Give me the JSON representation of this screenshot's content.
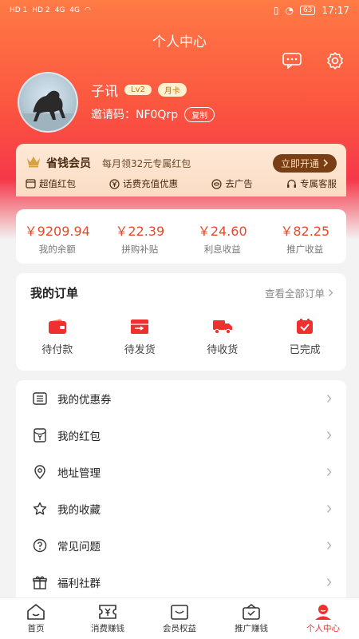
{
  "status": {
    "time": "17:17",
    "battery": "63",
    "left": [
      "HD 1",
      "HD 2",
      "4G",
      "4G"
    ]
  },
  "page": {
    "title": "个人中心"
  },
  "header_icons": [
    {
      "icon": "message-icon"
    },
    {
      "icon": "gear-icon"
    }
  ],
  "profile": {
    "name": "子讯",
    "level": "Lv2",
    "card": "月卡",
    "invite_label": "邀请码：",
    "invite_code": "NF0Qrp",
    "copy_label": "复制"
  },
  "vip": {
    "title": "省钱会员",
    "desc": "每月领32元专属红包",
    "button": "立即开通",
    "perks": [
      {
        "icon": "wallet-icon",
        "label": "超值红包"
      },
      {
        "icon": "yen-icon",
        "label": "话费充值优惠"
      },
      {
        "icon": "eye-icon",
        "label": "去广告"
      },
      {
        "icon": "headset-icon",
        "label": "专属客服"
      }
    ]
  },
  "stats": [
    {
      "value": "￥9209.94",
      "label": "我的余额"
    },
    {
      "value": "￥22.39",
      "label": "拼购补贴"
    },
    {
      "value": "￥24.60",
      "label": "利息收益"
    },
    {
      "value": "￥82.25",
      "label": "推广收益"
    }
  ],
  "orders": {
    "title": "我的订单",
    "view_all": "查看全部订单",
    "items": [
      {
        "icon": "wallet-icon",
        "label": "待付款"
      },
      {
        "icon": "package-icon",
        "label": "待发货"
      },
      {
        "icon": "truck-icon",
        "label": "待收货"
      },
      {
        "icon": "check-box-icon",
        "label": "已完成"
      }
    ]
  },
  "menu": [
    {
      "icon": "coupon-icon",
      "label": "我的优惠券"
    },
    {
      "icon": "red-packet-icon",
      "label": "我的红包"
    },
    {
      "icon": "location-icon",
      "label": "地址管理"
    },
    {
      "icon": "star-icon",
      "label": "我的收藏"
    },
    {
      "icon": "question-icon",
      "label": "常见问题"
    },
    {
      "icon": "gift-icon",
      "label": "福利社群"
    }
  ],
  "tabs": [
    {
      "icon": "home-icon",
      "label": "首页"
    },
    {
      "icon": "yen-ticket-icon",
      "label": "消费赚钱"
    },
    {
      "icon": "member-box-icon",
      "label": "会员权益"
    },
    {
      "icon": "promote-icon",
      "label": "推广赚钱"
    },
    {
      "icon": "user-icon",
      "label": "个人中心"
    }
  ],
  "colors": {
    "accent": "#f0302f",
    "value_red": "#e8492a",
    "vip_button": "#7a3e16"
  }
}
